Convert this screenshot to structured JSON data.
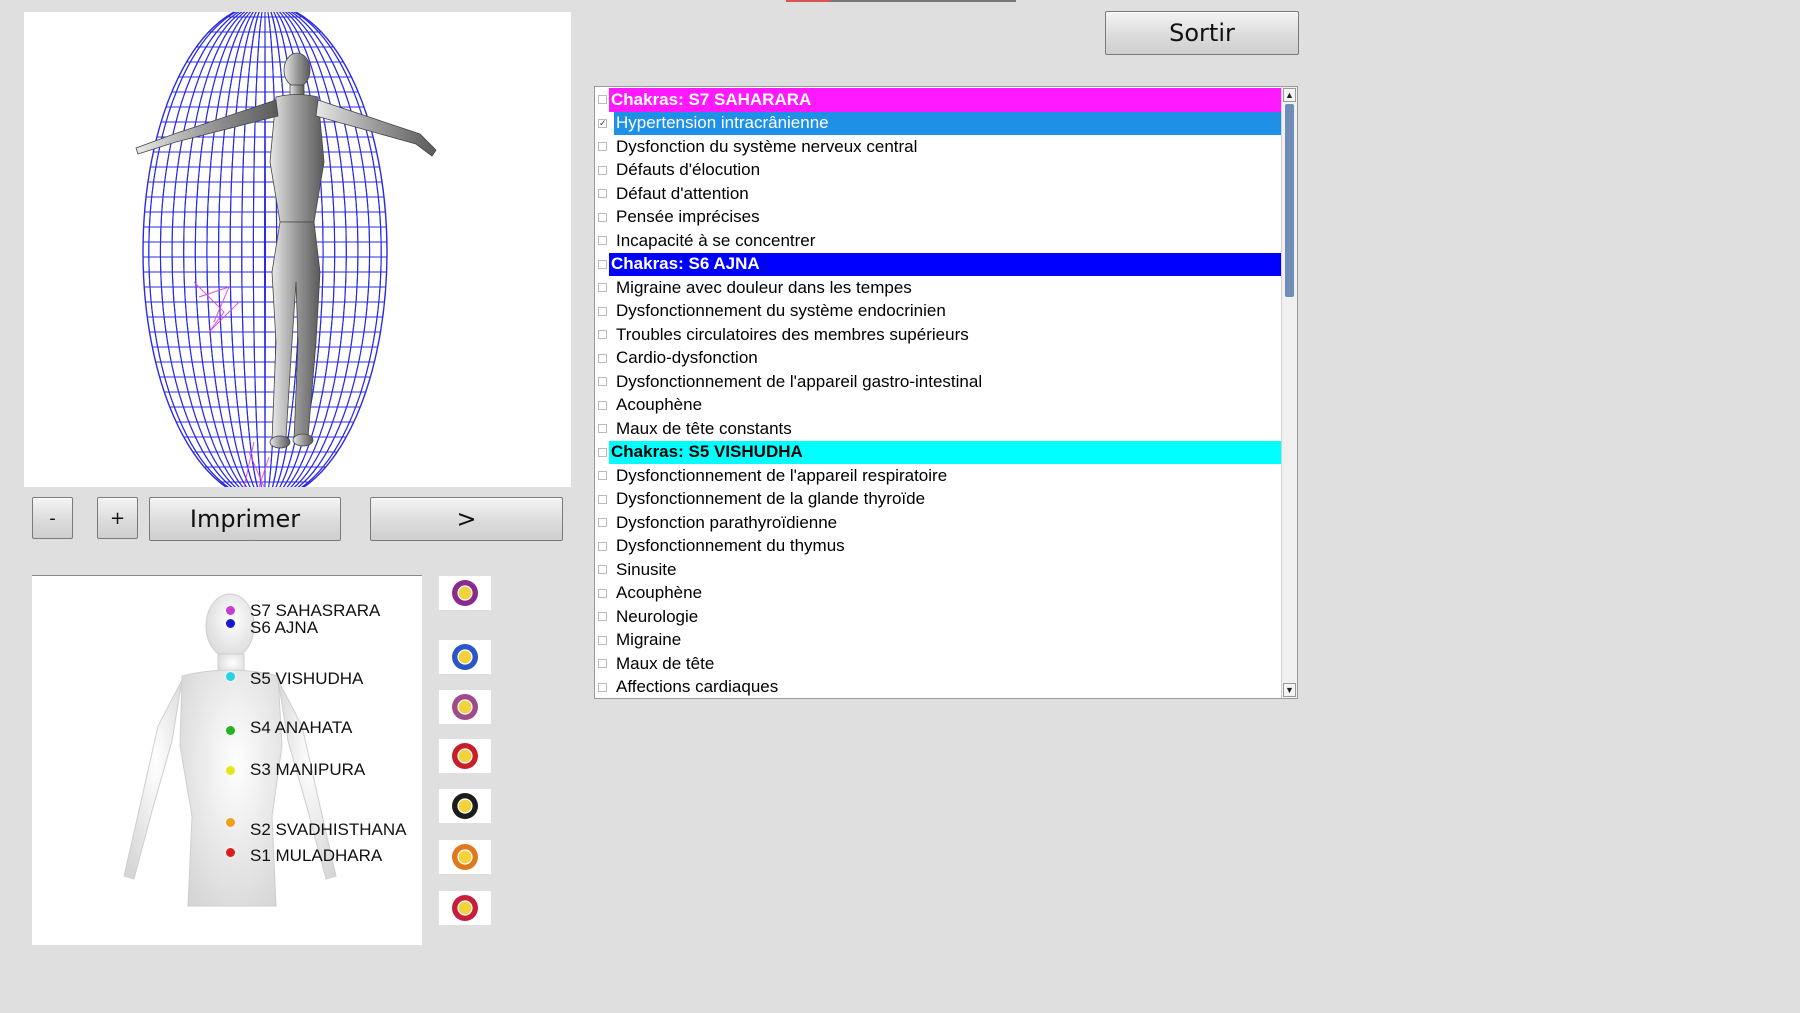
{
  "toolbar": {
    "exit_label": "Sortir",
    "zoom_out_label": "-",
    "zoom_in_label": "+",
    "print_label": "Imprimer",
    "next_label": ">"
  },
  "chakras": [
    {
      "label": "S7 SAHASRARA",
      "color": "#c83cd2"
    },
    {
      "label": "S6 AJNA",
      "color": "#1919d2"
    },
    {
      "label": "S5 VISHUDHA",
      "color": "#28d2e6"
    },
    {
      "label": "S4 ANAHATA",
      "color": "#23b423"
    },
    {
      "label": "S3 MANIPURA",
      "color": "#e6e61e"
    },
    {
      "label": "S2 SVADHISTHANA",
      "color": "#f0a01e"
    },
    {
      "label": "S1 MULADHARA",
      "color": "#dc1e1e"
    }
  ],
  "symbols": [
    {
      "name": "sahasrara-symbol-icon",
      "color": "#8a2a8a"
    },
    {
      "name": "ajna-symbol-icon",
      "color": "#2a56c8"
    },
    {
      "name": "vishudha-symbol-icon",
      "color": "#a04a8c"
    },
    {
      "name": "anahata-symbol-icon",
      "color": "#c81e2a"
    },
    {
      "name": "manipura-symbol-icon",
      "color": "#1c1c1c"
    },
    {
      "name": "svadhisthana-symbol-icon",
      "color": "#e0781e"
    },
    {
      "name": "muladhara-symbol-icon",
      "color": "#c81e3c"
    }
  ],
  "list": {
    "items": [
      {
        "type": "header",
        "text": "Chakras: S7 SAHARARA",
        "bg": "#ff19ff",
        "fg": "#ffffff"
      },
      {
        "type": "item",
        "text": "Hypertension intracrânienne",
        "selected": true,
        "checked": true
      },
      {
        "type": "item",
        "text": "Dysfonction du système nerveux central"
      },
      {
        "type": "item",
        "text": "Défauts d'élocution"
      },
      {
        "type": "item",
        "text": "Défaut d'attention"
      },
      {
        "type": "item",
        "text": "Pensée imprécises"
      },
      {
        "type": "item",
        "text": "Incapacité à se concentrer"
      },
      {
        "type": "header",
        "text": "Chakras: S6 AJNA",
        "bg": "#0000ff",
        "fg": "#ffffff"
      },
      {
        "type": "item",
        "text": "Migraine avec douleur dans les tempes"
      },
      {
        "type": "item",
        "text": "Dysfonctionnement du système endocrinien"
      },
      {
        "type": "item",
        "text": "Troubles circulatoires des membres supérieurs"
      },
      {
        "type": "item",
        "text": "Cardio-dysfonction"
      },
      {
        "type": "item",
        "text": "Dysfonctionnement de l'appareil gastro-intestinal"
      },
      {
        "type": "item",
        "text": "Acouphène"
      },
      {
        "type": "item",
        "text": "Maux de tête constants"
      },
      {
        "type": "header",
        "text": "Chakras: S5 VISHUDHA",
        "bg": "#00ffff",
        "fg": "#000000"
      },
      {
        "type": "item",
        "text": "Dysfonctionnement de l'appareil respiratoire"
      },
      {
        "type": "item",
        "text": "Dysfonctionnement de la glande thyroïde"
      },
      {
        "type": "item",
        "text": "Dysfonction parathyroïdienne"
      },
      {
        "type": "item",
        "text": "Dysfonctionnement du thymus"
      },
      {
        "type": "item",
        "text": "Sinusite"
      },
      {
        "type": "item",
        "text": "Acouphène"
      },
      {
        "type": "item",
        "text": "Neurologie"
      },
      {
        "type": "item",
        "text": "Migraine"
      },
      {
        "type": "item",
        "text": "Maux de tête"
      },
      {
        "type": "item",
        "text": "Affections cardiaques"
      }
    ],
    "selected_bg": "#1e90e6",
    "scroll_up_icon": "▲",
    "scroll_down_icon": "▼",
    "check_mark": "✓"
  }
}
